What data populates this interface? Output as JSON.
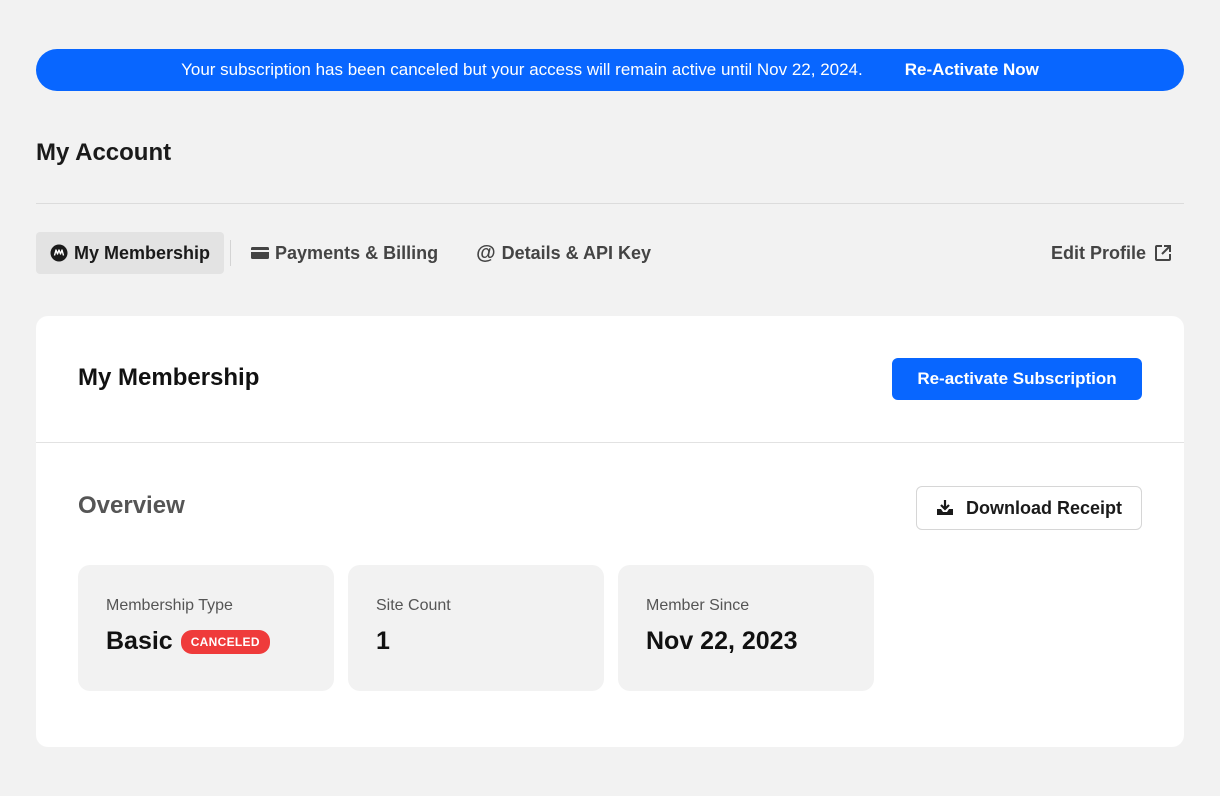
{
  "banner": {
    "message": "Your subscription has been canceled but your access will remain active until Nov 22, 2024.",
    "cta": "Re-Activate Now",
    "color": "#0866ff"
  },
  "page": {
    "title": "My Account"
  },
  "tabs": [
    {
      "label": "My Membership",
      "icon": "membership-logo-icon",
      "active": true
    },
    {
      "label": "Payments & Billing",
      "icon": "credit-card-icon",
      "active": false
    },
    {
      "label": "Details & API Key",
      "icon": "at-sign-icon",
      "active": false
    }
  ],
  "edit_profile": {
    "label": "Edit Profile",
    "icon": "external-link-icon"
  },
  "card": {
    "title": "My Membership",
    "reactivate_button": "Re-activate Subscription",
    "overview_title": "Overview",
    "download_button": "Download Receipt",
    "download_icon": "download-tray-icon"
  },
  "stats": [
    {
      "label": "Membership Type",
      "value": "Basic",
      "badge": "CANCELED",
      "badge_color": "#ef3b3b"
    },
    {
      "label": "Site Count",
      "value": "1"
    },
    {
      "label": "Member Since",
      "value": "Nov 22, 2023"
    }
  ]
}
